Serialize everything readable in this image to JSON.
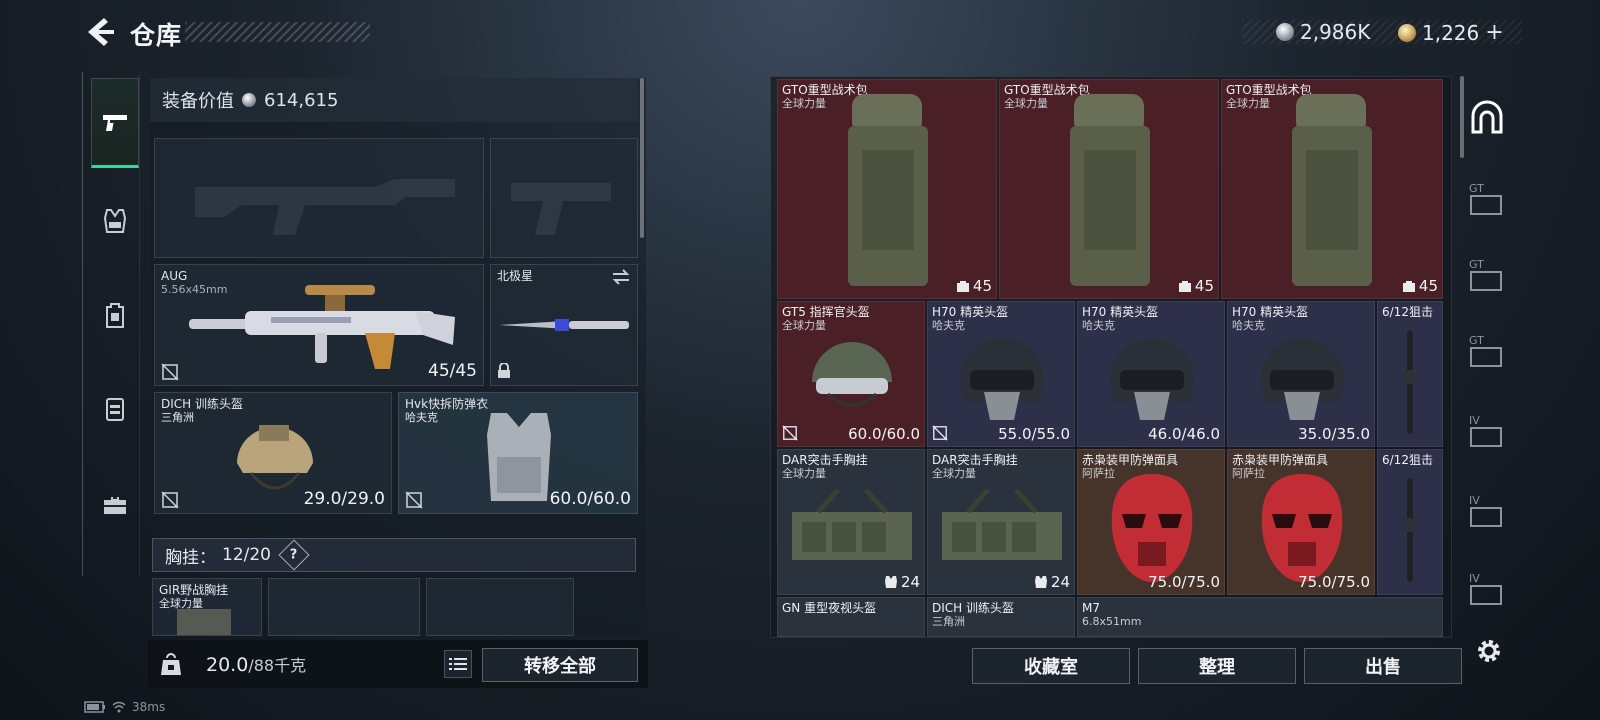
{
  "header": {
    "title": "仓库",
    "currencies": [
      {
        "icon": "silver-coin-icon",
        "value": "2,986K"
      },
      {
        "icon": "gold-coin-icon",
        "value": "1,226"
      }
    ],
    "add_symbol": "+"
  },
  "rail": {
    "items": [
      {
        "icon": "pistol-icon",
        "active": true
      },
      {
        "icon": "armor-vest-icon",
        "active": false
      },
      {
        "icon": "backpack-icon",
        "active": false
      },
      {
        "icon": "container-icon",
        "active": false
      },
      {
        "icon": "briefcase-icon",
        "active": false
      }
    ]
  },
  "equipment": {
    "value_label": "装备价值",
    "value": "614,615",
    "primary": {
      "name": "AUG",
      "ammo": "5.56x45mm",
      "value": "45/45"
    },
    "melee": {
      "name": "北极星"
    },
    "helmet": {
      "name": "DICH 训练头盔",
      "brand": "三角洲",
      "value": "29.0/29.0"
    },
    "armor": {
      "name": "Hvk快拆防弹衣",
      "brand": "哈夫克",
      "value": "60.0/60.0"
    },
    "vest_bar": {
      "label": "胸挂：",
      "capacity": "12/20",
      "help": "?"
    },
    "vest_item": {
      "name": "GIR野战胸挂",
      "brand": "全球力量"
    }
  },
  "weight": {
    "current": "20.0",
    "max": "/88千克"
  },
  "buttons": {
    "transfer_all": "转移全部",
    "collection": "收藏室",
    "organize": "整理",
    "sell": "出售"
  },
  "storage": {
    "row1": [
      {
        "name": "GTO重型战术包",
        "brand": "全球力量",
        "value": "45"
      },
      {
        "name": "GTO重型战术包",
        "brand": "全球力量",
        "value": "45"
      },
      {
        "name": "GTO重型战术包",
        "brand": "全球力量",
        "value": "45"
      }
    ],
    "row2": [
      {
        "name": "GT5 指挥官头盔",
        "brand": "全球力量",
        "value": "60.0/60.0"
      },
      {
        "name": "H70 精英头盔",
        "brand": "哈夫克",
        "value": "55.0/55.0"
      },
      {
        "name": "H70 精英头盔",
        "brand": "哈夫克",
        "value": "46.0/46.0"
      },
      {
        "name": "H70 精英头盔",
        "brand": "哈夫克",
        "value": "35.0/35.0"
      },
      {
        "name": "6/12狙击"
      }
    ],
    "row3": [
      {
        "name": "DAR突击手胸挂",
        "brand": "全球力量",
        "value": "24"
      },
      {
        "name": "DAR突击手胸挂",
        "brand": "全球力量",
        "value": "24"
      },
      {
        "name": "赤枭装甲防弹面具",
        "brand": "阿萨拉",
        "value": "75.0/75.0"
      },
      {
        "name": "赤枭装甲防弹面具",
        "brand": "阿萨拉",
        "value": "75.0/75.0"
      },
      {
        "name": "6/12狙击"
      }
    ],
    "row4": [
      {
        "name": "GN 重型夜视头盔"
      },
      {
        "name": "DICH 训练头盔",
        "brand": "三角洲"
      },
      {
        "name": "M7",
        "brand": "6.8x51mm"
      }
    ]
  },
  "right_rail": {
    "items": [
      {
        "icon": "storage-arch-icon",
        "label": ""
      },
      {
        "icon": "gt-case-icon",
        "label": "GT"
      },
      {
        "icon": "gt-case-icon",
        "label": "GT"
      },
      {
        "icon": "gt-case-icon",
        "label": "GT"
      },
      {
        "icon": "iv-case-icon",
        "label": "IV"
      },
      {
        "icon": "iv-case-icon",
        "label": "IV"
      },
      {
        "icon": "iv-case-icon",
        "label": "IV"
      }
    ]
  },
  "status": {
    "ping": "38ms"
  }
}
